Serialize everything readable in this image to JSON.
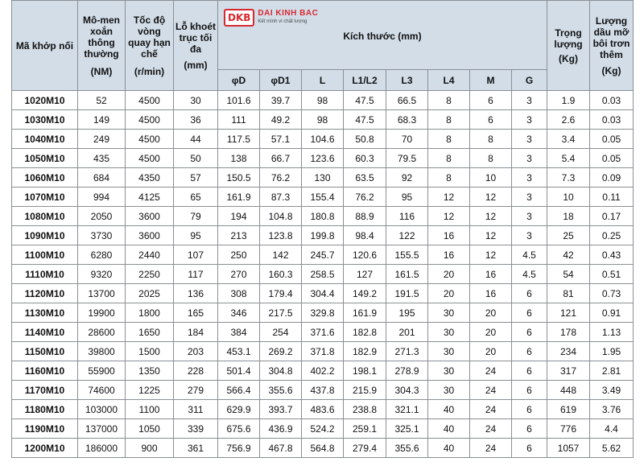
{
  "logo": {
    "mark": "DKB",
    "name": "DAI KINH BAC",
    "tagline": "Kết mình vì chất lượng"
  },
  "headers": {
    "code": "Mã khớp nối",
    "torque": "Mô-men xoắn thông thường",
    "torque_unit": "(NM)",
    "speed": "Tốc độ vòng quay hạn chế",
    "speed_unit": "(r/min)",
    "bore": "Lỗ khoét trục tối đa",
    "bore_unit": "(mm)",
    "dimensions": "Kích thước (mm)",
    "dim_cols": [
      "φD",
      "φD1",
      "L",
      "L1/L2",
      "L3",
      "L4",
      "M",
      "G"
    ],
    "weight": "Trọng lượng",
    "weight_unit": "(Kg)",
    "grease": "Lượng dầu mỡ bôi trơn thêm",
    "grease_unit": "(Kg)"
  },
  "rows": [
    [
      "1020M10",
      "52",
      "4500",
      "30",
      "101.6",
      "39.7",
      "98",
      "47.5",
      "66.5",
      "8",
      "6",
      "3",
      "1.9",
      "0.03"
    ],
    [
      "1030M10",
      "149",
      "4500",
      "36",
      "111",
      "49.2",
      "98",
      "47.5",
      "68.3",
      "8",
      "6",
      "3",
      "2.6",
      "0.03"
    ],
    [
      "1040M10",
      "249",
      "4500",
      "44",
      "117.5",
      "57.1",
      "104.6",
      "50.8",
      "70",
      "8",
      "8",
      "3",
      "3.4",
      "0.05"
    ],
    [
      "1050M10",
      "435",
      "4500",
      "50",
      "138",
      "66.7",
      "123.6",
      "60.3",
      "79.5",
      "8",
      "8",
      "3",
      "5.4",
      "0.05"
    ],
    [
      "1060M10",
      "684",
      "4350",
      "57",
      "150.5",
      "76.2",
      "130",
      "63.5",
      "92",
      "8",
      "10",
      "3",
      "7.3",
      "0.09"
    ],
    [
      "1070M10",
      "994",
      "4125",
      "65",
      "161.9",
      "87.3",
      "155.4",
      "76.2",
      "95",
      "12",
      "12",
      "3",
      "10",
      "0.11"
    ],
    [
      "1080M10",
      "2050",
      "3600",
      "79",
      "194",
      "104.8",
      "180.8",
      "88.9",
      "116",
      "12",
      "12",
      "3",
      "18",
      "0.17"
    ],
    [
      "1090M10",
      "3730",
      "3600",
      "95",
      "213",
      "123.8",
      "199.8",
      "98.4",
      "122",
      "16",
      "12",
      "3",
      "25",
      "0.25"
    ],
    [
      "1100M10",
      "6280",
      "2440",
      "107",
      "250",
      "142",
      "245.7",
      "120.6",
      "155.5",
      "16",
      "12",
      "4.5",
      "42",
      "0.43"
    ],
    [
      "1110M10",
      "9320",
      "2250",
      "117",
      "270",
      "160.3",
      "258.5",
      "127",
      "161.5",
      "20",
      "16",
      "4.5",
      "54",
      "0.51"
    ],
    [
      "1120M10",
      "13700",
      "2025",
      "136",
      "308",
      "179.4",
      "304.4",
      "149.2",
      "191.5",
      "20",
      "16",
      "6",
      "81",
      "0.73"
    ],
    [
      "1130M10",
      "19900",
      "1800",
      "165",
      "346",
      "217.5",
      "329.8",
      "161.9",
      "195",
      "30",
      "20",
      "6",
      "121",
      "0.91"
    ],
    [
      "1140M10",
      "28600",
      "1650",
      "184",
      "384",
      "254",
      "371.6",
      "182.8",
      "201",
      "30",
      "20",
      "6",
      "178",
      "1.13"
    ],
    [
      "1150M10",
      "39800",
      "1500",
      "203",
      "453.1",
      "269.2",
      "371.8",
      "182.9",
      "271.3",
      "30",
      "20",
      "6",
      "234",
      "1.95"
    ],
    [
      "1160M10",
      "55900",
      "1350",
      "228",
      "501.4",
      "304.8",
      "402.2",
      "198.1",
      "278.9",
      "30",
      "24",
      "6",
      "317",
      "2.81"
    ],
    [
      "1170M10",
      "74600",
      "1225",
      "279",
      "566.4",
      "355.6",
      "437.8",
      "215.9",
      "304.3",
      "30",
      "24",
      "6",
      "448",
      "3.49"
    ],
    [
      "1180M10",
      "103000",
      "1100",
      "311",
      "629.9",
      "393.7",
      "483.6",
      "238.8",
      "321.1",
      "40",
      "24",
      "6",
      "619",
      "3.76"
    ],
    [
      "1190M10",
      "137000",
      "1050",
      "339",
      "675.6",
      "436.9",
      "524.2",
      "259.1",
      "325.1",
      "40",
      "24",
      "6",
      "776",
      "4.4"
    ],
    [
      "1200M10",
      "186000",
      "900",
      "361",
      "756.9",
      "467.8",
      "564.8",
      "279.4",
      "355.6",
      "40",
      "24",
      "6",
      "1057",
      "5.62"
    ]
  ]
}
